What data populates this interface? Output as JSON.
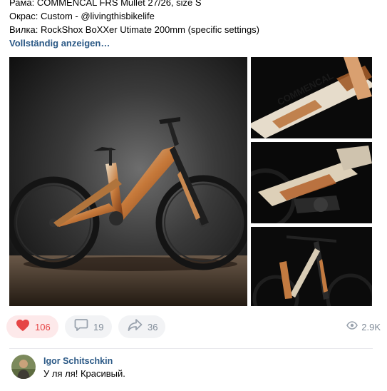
{
  "post": {
    "lines": [
      "Рама: COMMENCAL FRS Mullet 27/26, size S",
      "Окрас: Custom - @livingthisbikelife",
      "Вилка: RockShox BoXXer Utimate 200mm (specific settings)"
    ],
    "show_more": "Vollständig anzeigen…"
  },
  "gallery": {
    "main_alt": "bike-photo",
    "thumb_logo": "COMMENCAL"
  },
  "actions": {
    "likes": "106",
    "comments": "19",
    "shares": "36",
    "views": "2.9K",
    "liked": true,
    "like_color": "#e64646",
    "icons": [
      "heart-icon",
      "comment-icon",
      "share-icon",
      "eye-icon"
    ]
  },
  "comment": {
    "author": "Igor Schitschkin",
    "text": "У ля ля! Красивый."
  },
  "colors": {
    "link": "#2a5885",
    "muted": "#818c99",
    "pill_bg": "#f2f3f5"
  }
}
